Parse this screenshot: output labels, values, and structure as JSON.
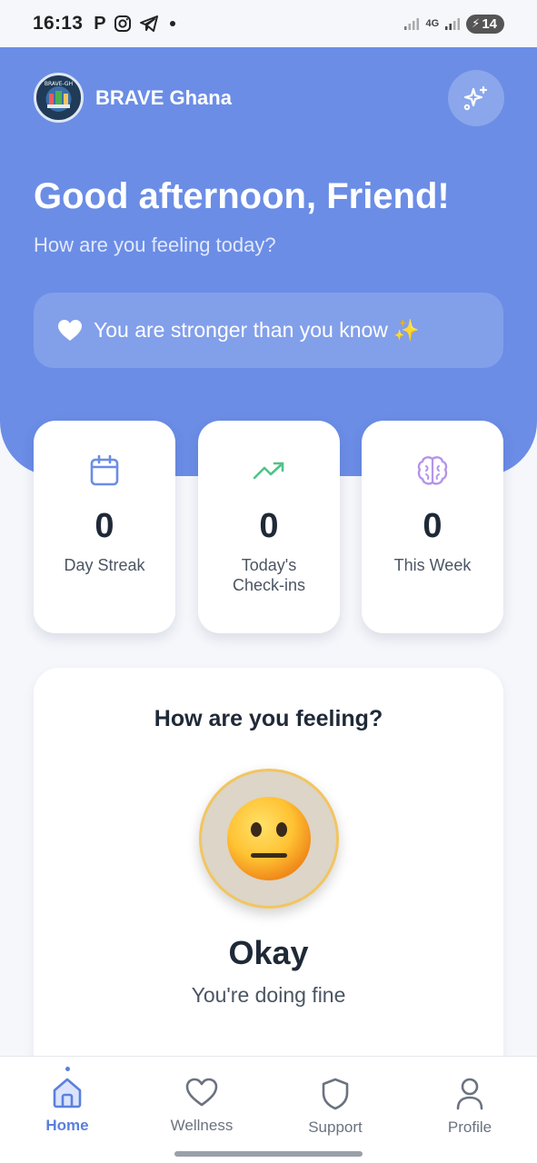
{
  "status_bar": {
    "time": "16:13",
    "network": "4G",
    "battery": "14"
  },
  "app": {
    "brand_name": "BRAVE Ghana",
    "logo_text": "BRAVE-GH"
  },
  "hero": {
    "greeting": "Good afternoon, Friend!",
    "subtitle": "How are you feeling today?",
    "affirmation": "You are stronger than you know ✨"
  },
  "stats": [
    {
      "value": "0",
      "label": "Day Streak",
      "icon": "calendar-icon"
    },
    {
      "value": "0",
      "label": "Today's Check-ins",
      "icon": "trending-up-icon"
    },
    {
      "value": "0",
      "label": "This Week",
      "icon": "brain-icon"
    }
  ],
  "mood": {
    "title": "How are you feeling?",
    "emoji": "😐",
    "word": "Okay",
    "description": "You're doing fine"
  },
  "nav": [
    {
      "label": "Home",
      "icon": "home-icon",
      "active": true
    },
    {
      "label": "Wellness",
      "icon": "heart-icon",
      "active": false
    },
    {
      "label": "Support",
      "icon": "shield-icon",
      "active": false
    },
    {
      "label": "Profile",
      "icon": "user-icon",
      "active": false
    }
  ],
  "colors": {
    "primary": "#6b8de6",
    "nav_active": "#5b7fde",
    "calendar_icon": "#6b8de6",
    "trend_icon": "#4fc488",
    "brain_icon": "#b494e8",
    "emoji_ring_border": "#f2c560"
  }
}
